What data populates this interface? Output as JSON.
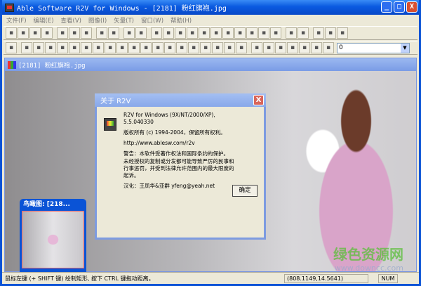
{
  "window": {
    "title": "Able Software R2V for Windows - [2181] 粉红旗袍.jpg",
    "minimize": "_",
    "maximize": "□",
    "close": "X"
  },
  "menu": [
    "文件(F)",
    "编辑(E)",
    "查看(V)",
    "图像(I)",
    "矢量(T)",
    "窗口(W)",
    "帮助(H)"
  ],
  "toolbar1": [
    "open-icon",
    "save-icon",
    "save-all-icon",
    "print-icon",
    "zoom-in-icon",
    "zoom-out-icon",
    "select-vector-icon",
    "undo-icon",
    "pointer-icon",
    "grid-icon",
    "image-icon",
    "trace-icon",
    "rectangle-icon",
    "fill-rect-icon",
    "line-icon",
    "node-icon",
    "measure-icon",
    "plus-icon",
    "split-icon",
    "target-icon",
    "histogram-icon",
    "chart-icon",
    "crosshair-icon",
    "pick-icon",
    "edit-icon",
    "help-icon",
    "context-help-icon"
  ],
  "toolbar2": [
    "clock-icon",
    "draw-line-icon",
    "polygon-icon",
    "curve-icon",
    "vertical-icon",
    "horizontal-icon",
    "angle-icon",
    "extend-icon",
    "points-icon",
    "diagonal-icon",
    "square-icon",
    "slope-icon",
    "corner-icon",
    "join-icon",
    "dash-icon",
    "level-icon",
    "hatch-icon",
    "text-icon",
    "fill-icon",
    "align-icon",
    "arrow-icon",
    "add-node-icon",
    "delete-node-icon",
    "move-node-icon",
    "node-label-icon",
    "dot-icon",
    "snap-icon"
  ],
  "toolbar2_combo_value": "0",
  "document": {
    "title": "[2181] 粉红旗袍.jpg"
  },
  "about_dialog": {
    "title": "关于 R2V",
    "close": "X",
    "version": "R2V for Windows (9X/NT/2000/XP), 5.5.040330",
    "copyright": "版权所有 (c) 1994-2004，保留所有权利。",
    "url": "http://www.ablesw.com/r2v",
    "warning1": "警告：本软件受著作权法和国际条约的保护。",
    "warning2": "未经授权的复制或分发都可能导致严厉的民事和行事惩罚，并受到法律允许范围内的最大限度的起诉。",
    "translator": "汉化：王凤华&亚群 yfeng@yeah.net",
    "ok": "确定"
  },
  "birdseye": {
    "title": "鸟瞰图: [218..."
  },
  "watermark": {
    "name": "绿色资源网",
    "url": "www.downcc.com"
  },
  "status": {
    "message": "鼠标左键 (+ SHIFT 键) 绘制矩形, 按下 CTRL 键拖动距离。",
    "coords": "(808.1149,14.5641)",
    "num": "NUM"
  }
}
